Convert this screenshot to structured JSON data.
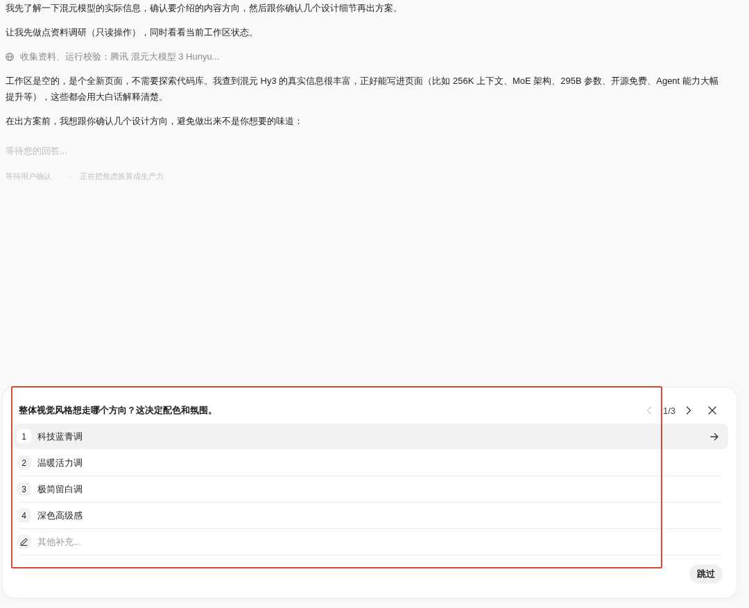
{
  "messages": [
    {
      "kind": "text",
      "text": "我先了解一下混元模型的实际信息，确认要介绍的内容方向，然后跟你确认几个设计细节再出方案。"
    },
    {
      "kind": "text",
      "text": "让我先做点资料调研（只读操作），同时看看当前工作区状态。"
    },
    {
      "kind": "tool",
      "text": "收集资料、运行校验：腾讯 混元大模型 3 Hunyu..."
    },
    {
      "kind": "text",
      "text": "工作区是空的，是个全新页面，不需要探索代码库。我查到混元 Hy3 的真实信息很丰富，正好能写进页面（比如 256K 上下文、MoE 架构、295B 参数、开源免费、Agent 能力大幅提升等），这些都会用大白话解释清楚。"
    },
    {
      "kind": "text",
      "text": "在出方案前，我想跟你确认几个设计方向，避免做出来不是你想要的味道："
    }
  ],
  "waiting": "等待您的回答...",
  "status": {
    "state": "等待用户确认",
    "separator": "·",
    "activity": "正在把焦虑换算成生产力"
  },
  "question_card": {
    "question": "整体视觉风格想走哪个方向？这决定配色和氛围。",
    "pager": {
      "page": "1/3",
      "prev_disabled": true,
      "next_disabled": false
    },
    "options": [
      {
        "number": "1",
        "label": "科技蓝青调",
        "selected": true
      },
      {
        "number": "2",
        "label": "温暖活力调",
        "selected": false
      },
      {
        "number": "3",
        "label": "极简留白调",
        "selected": false
      },
      {
        "number": "4",
        "label": "深色高级感",
        "selected": false
      }
    ],
    "other": {
      "placeholder": "其他补充..."
    },
    "skip_button": "跳过"
  }
}
